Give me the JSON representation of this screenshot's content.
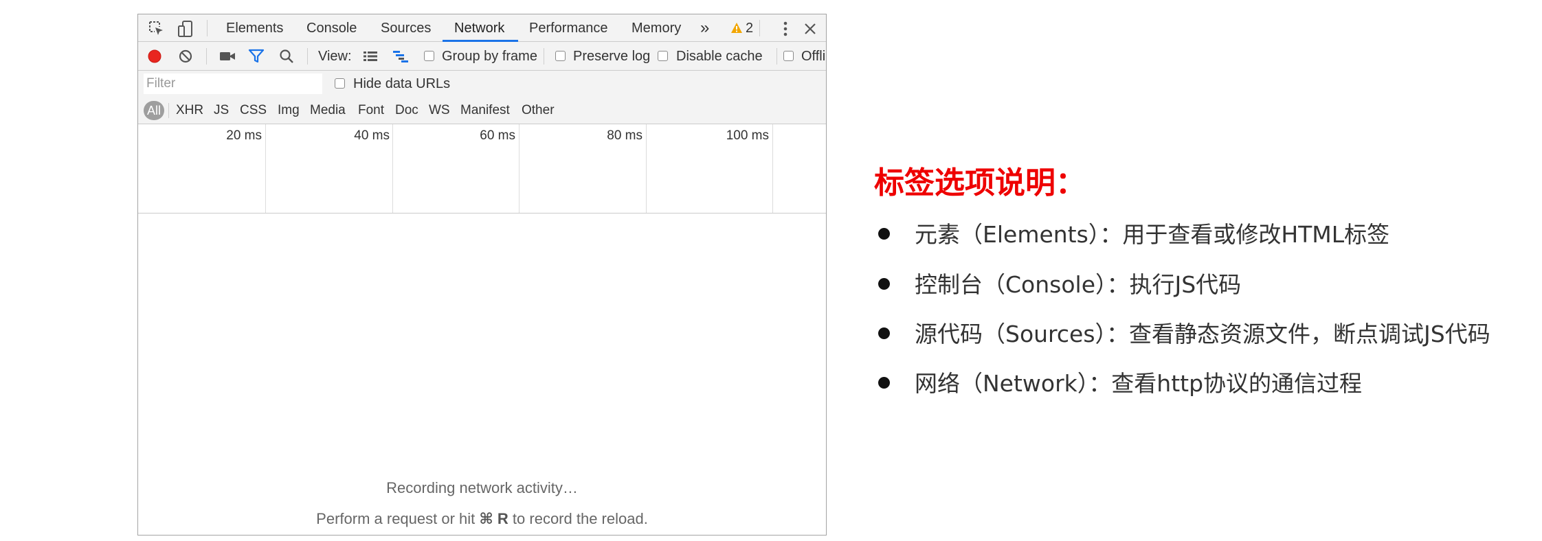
{
  "devtools": {
    "tabs": [
      {
        "label": "Elements"
      },
      {
        "label": "Console"
      },
      {
        "label": "Sources"
      },
      {
        "label": "Network",
        "active": true
      },
      {
        "label": "Performance"
      },
      {
        "label": "Memory"
      }
    ],
    "more_tabs_label": "»",
    "warning_count": "2",
    "toolbar": {
      "view_label": "View:",
      "group_by_frame": "Group by frame",
      "preserve_log": "Preserve log",
      "disable_cache": "Disable cache",
      "offline": "Offlin"
    },
    "filter": {
      "placeholder": "Filter",
      "hide_data_urls": "Hide data URLs"
    },
    "resource_types": [
      "All",
      "XHR",
      "JS",
      "CSS",
      "Img",
      "Media",
      "Font",
      "Doc",
      "WS",
      "Manifest",
      "Other"
    ],
    "timeline_ticks": [
      "20 ms",
      "40 ms",
      "60 ms",
      "80 ms",
      "100 ms"
    ],
    "empty_state": {
      "line1": "Recording network activity…",
      "line2_prefix": "Perform a request or hit ",
      "line2_key": "⌘ R",
      "line2_suffix": " to record the reload."
    },
    "colors": {
      "record": "#e8261f",
      "accent": "#1a73e8",
      "warning": "#f2a600"
    }
  },
  "notes": {
    "title": "标签选项说明：",
    "items": [
      "元素（Elements）：用于查看或修改HTML标签",
      "控制台（Console）：执行JS代码",
      "源代码（Sources）：查看静态资源文件，断点调试JS代码",
      "网络（Network）：查看http协议的通信过程"
    ]
  }
}
